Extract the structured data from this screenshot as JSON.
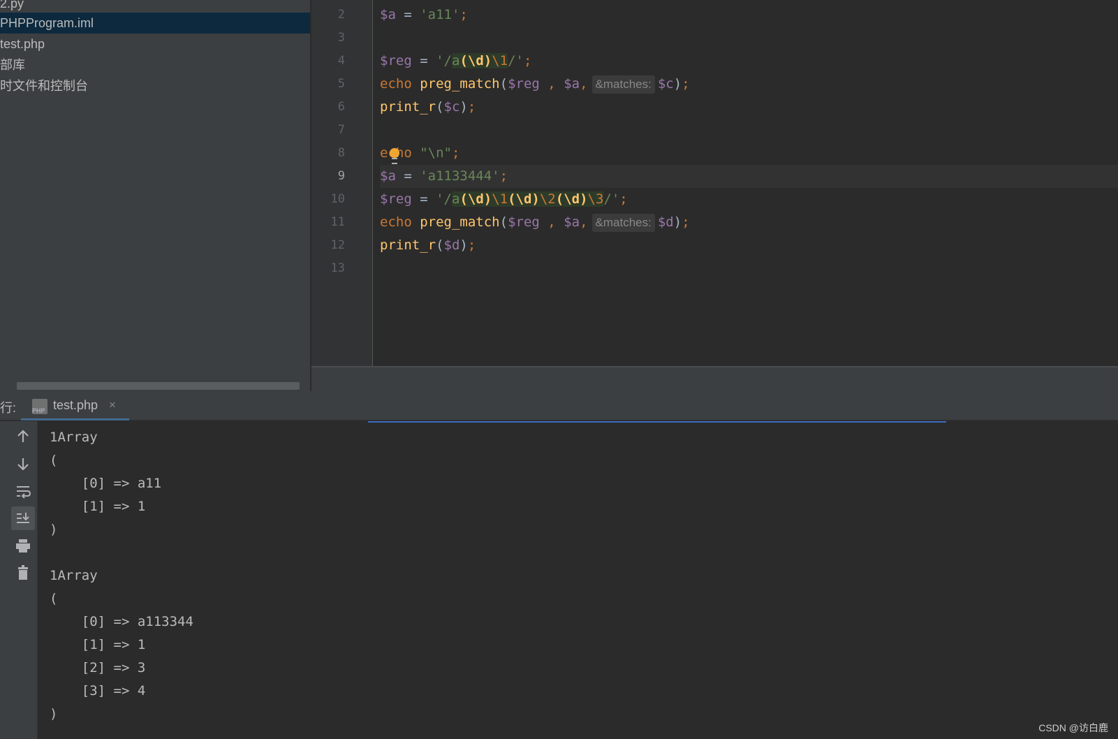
{
  "project": {
    "items": [
      {
        "label": "2.py",
        "selected": false
      },
      {
        "label": "PHPProgram.iml",
        "selected": true
      },
      {
        "label": "test.php",
        "selected": false
      },
      {
        "label": "部库",
        "selected": false
      },
      {
        "label": "时文件和控制台",
        "selected": false
      }
    ]
  },
  "editor": {
    "line_numbers": [
      "2",
      "3",
      "4",
      "5",
      "6",
      "7",
      "8",
      "9",
      "10",
      "11",
      "12",
      "13"
    ],
    "current_line": "9",
    "hint_label": "&matches:"
  },
  "run": {
    "label": "行:",
    "tab_label": "test.php",
    "tab_icon_text": "PHP",
    "close_glyph": "×",
    "output": [
      "1Array",
      "(",
      "    [0] => a11",
      "    [1] => 1",
      ")",
      "",
      "1Array",
      "(",
      "    [0] => a113344",
      "    [1] => 1",
      "    [2] => 3",
      "    [3] => 4",
      ")"
    ]
  },
  "toolbar_icons": [
    "arrow-up-icon",
    "arrow-down-icon",
    "soft-wrap-icon",
    "scroll-to-end-icon",
    "print-icon",
    "trash-icon"
  ],
  "watermark": "CSDN @访白鹿",
  "colors": {
    "variable": "#9876aa",
    "string": "#6a8759",
    "keyword": "#cc7832",
    "function": "#ffc66d",
    "selection": "#0d293e"
  }
}
